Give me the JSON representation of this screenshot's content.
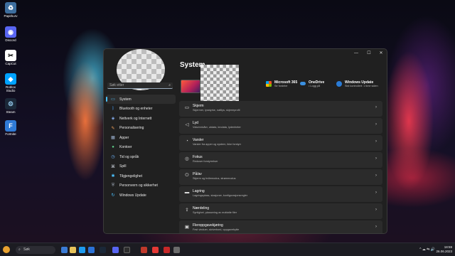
{
  "desktop_icons": [
    {
      "label": "Papirkurv",
      "icon": "recycle-bin-icon",
      "color": "#3d6e9e"
    },
    {
      "label": "Discord",
      "icon": "discord-icon",
      "color": "#5865f2"
    },
    {
      "label": "CapCut",
      "icon": "capcut-icon",
      "color": "#ffffff"
    },
    {
      "label": "Roblox Studio",
      "icon": "roblox-studio-icon",
      "color": "#00a2ff"
    },
    {
      "label": "Steam",
      "icon": "steam-icon",
      "color": "#1b2838"
    },
    {
      "label": "Fortnite",
      "icon": "fortnite-icon",
      "color": "#2f7ad6"
    }
  ],
  "window": {
    "search_placeholder": "Søk etter",
    "page_title": "System",
    "controls": {
      "minimize": "—",
      "maximize": "☐",
      "close": "✕"
    }
  },
  "sidebar": {
    "items": [
      {
        "label": "System",
        "icon": "monitor-icon",
        "active": true
      },
      {
        "label": "Bluetooth og enheter",
        "icon": "bluetooth-icon"
      },
      {
        "label": "Nettverk og Internett",
        "icon": "wifi-icon"
      },
      {
        "label": "Personalisering",
        "icon": "brush-icon"
      },
      {
        "label": "Apper",
        "icon": "apps-icon"
      },
      {
        "label": "Kontoer",
        "icon": "account-icon"
      },
      {
        "label": "Tid og språk",
        "icon": "clock-icon"
      },
      {
        "label": "Spill",
        "icon": "gamepad-icon"
      },
      {
        "label": "Tilgjengelighet",
        "icon": "accessibility-icon"
      },
      {
        "label": "Personvern og sikkerhet",
        "icon": "shield-icon"
      },
      {
        "label": "Windows Update",
        "icon": "update-icon"
      }
    ]
  },
  "quick_links": [
    {
      "title": "Microsoft 365",
      "subtitle": "Se fordeler",
      "icon": "microsoft-365-icon"
    },
    {
      "title": "OneDrive",
      "subtitle": "• Logg på",
      "icon": "onedrive-icon"
    },
    {
      "title": "Windows Update",
      "subtitle": "Sist kontrollert: 1 time siden",
      "icon": "windows-update-icon"
    }
  ],
  "settings_rows": [
    {
      "title": "Skjerm",
      "subtitle": "Skjermer, lysstyrke, nattlys, skjermprofil",
      "icon": "display-icon"
    },
    {
      "title": "Lyd",
      "subtitle": "Volumnivåer, utdata, inndata, lydenheter",
      "icon": "speaker-icon"
    },
    {
      "title": "Varsler",
      "subtitle": "Varsler fra apper og system, ikke forstyrr",
      "icon": "bell-icon"
    },
    {
      "title": "Fokus",
      "subtitle": "Reduser forstyrrelser",
      "icon": "focus-icon"
    },
    {
      "title": "På/av",
      "subtitle": "Skjerm og hvilemodus, strømmodus",
      "icon": "power-icon"
    },
    {
      "title": "Lagring",
      "subtitle": "Lagringsplass, stasjoner, konfigurasjonsregler",
      "icon": "storage-icon"
    },
    {
      "title": "Nærdeling",
      "subtitle": "Synlighet, plassering av mottatte filer",
      "icon": "nearby-share-icon"
    },
    {
      "title": "Fleroppgavekjøring",
      "subtitle": "Fest vinduer, skrivebord, oppgavebytte",
      "icon": "multitasking-icon"
    }
  ],
  "taskbar": {
    "search_label": "Søk",
    "tray_icons": "^ ☁ ⇆ 🔊",
    "language": "NB",
    "time": "18:59",
    "date": "26.06.2023"
  }
}
